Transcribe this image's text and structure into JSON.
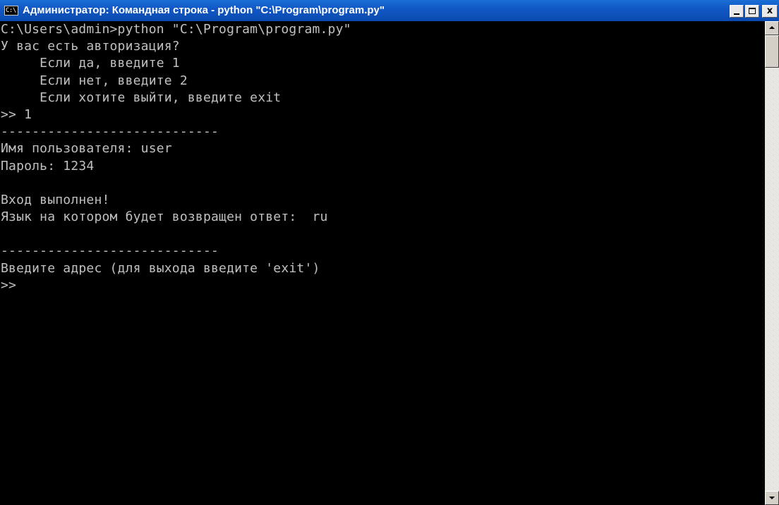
{
  "window": {
    "title": "Администратор: Командная строка - python  \"C:\\Program\\program.py\"",
    "icon_label": "C:\\",
    "title_color": "#1158c6"
  },
  "caption_buttons": {
    "close_label": "x"
  },
  "console": {
    "text_color": "#c0c0c0",
    "background_color": "#000000",
    "lines": [
      "C:\\Users\\admin>python \"C:\\Program\\program.py\"",
      "У вас есть авторизация?",
      "     Если да, введите 1",
      "     Если нет, введите 2",
      "     Если хотите выйти, введите exit",
      ">> 1",
      "----------------------------",
      "Имя пользователя: user",
      "Пароль: 1234",
      "",
      "Вход выполнен!",
      "Язык на котором будет возвращен ответ:  ru",
      "",
      "----------------------------",
      "Введите адрес (для выхода введите 'exit')",
      ">>"
    ]
  },
  "icons": {
    "window_icon": "console-icon",
    "minimize": "minimize-icon",
    "maximize": "maximize-icon",
    "close": "close-icon",
    "scroll_up": "arrow-up-icon",
    "scroll_down": "arrow-down-icon"
  }
}
